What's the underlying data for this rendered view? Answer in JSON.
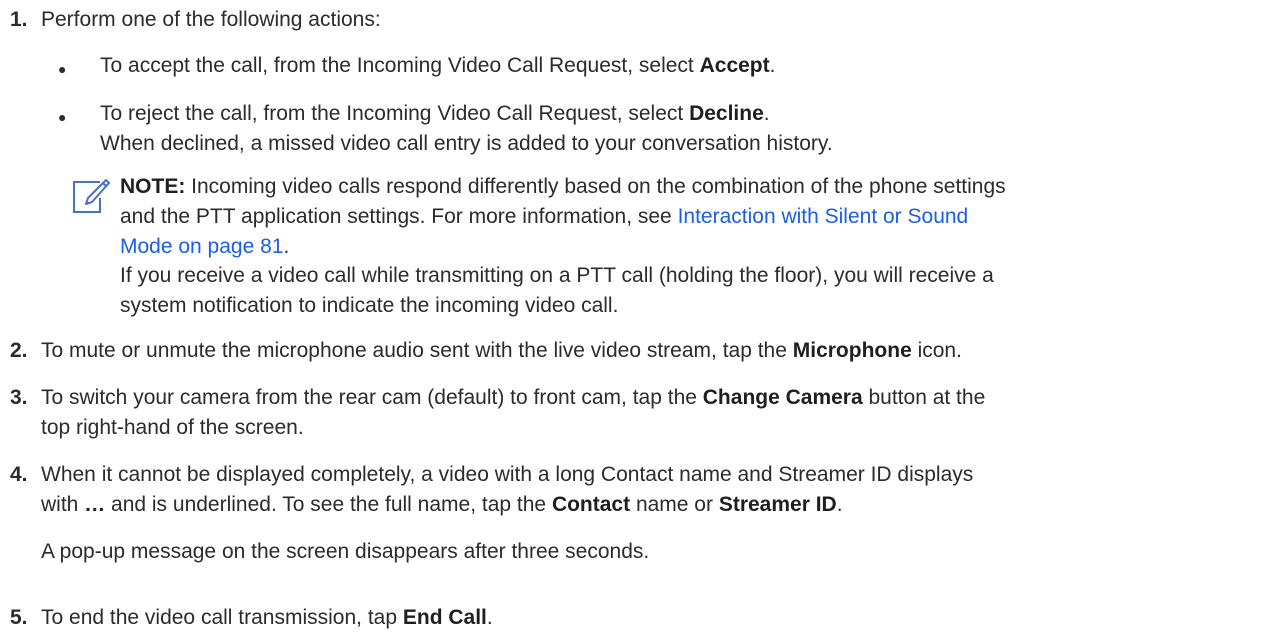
{
  "steps": [
    {
      "number": "1.",
      "text": "Perform one of the following actions:"
    },
    {
      "number": "2.",
      "text_before": "To mute or unmute the microphone audio sent with the live video stream, tap the ",
      "bold": "Microphone",
      "text_after": " icon."
    },
    {
      "number": "3.",
      "line1_before": "To switch your camera from the rear cam (default) to front cam, tap the ",
      "line1_bold": "Change Camera",
      "line1_after": " button at the",
      "line2": "top right-hand of the screen."
    },
    {
      "number": "4.",
      "line1": "When it cannot be displayed completely, a video with a long Contact name and Streamer ID displays",
      "line2_with": "with ",
      "line2_ellipsis": "…",
      "line2_mid": " and is underlined. To see the full name, tap the ",
      "line2_bold1": "Contact",
      "line2_or": " name or ",
      "line2_bold2": "Streamer ID",
      "line2_end": ".",
      "result": "A pop-up message on the screen disappears after three seconds."
    },
    {
      "number": "5.",
      "text_before": "To end the video call transmission, tap ",
      "bold": "End Call",
      "text_after": "."
    }
  ],
  "bullets": [
    {
      "symbol": "●",
      "text_before": "To accept the call, from the Incoming Video Call Request, select ",
      "bold": "Accept",
      "text_after": "."
    },
    {
      "symbol": "●",
      "text_before": "To reject the call, from the Incoming Video Call Request, select ",
      "bold": "Decline",
      "text_after": ".",
      "line2": "When declined, a missed video call entry is added to your conversation history."
    }
  ],
  "note": {
    "label": "NOTE:",
    "line1": " Incoming video calls respond differently based on the combination of the phone settings",
    "line2_before": "and the PTT application settings. For more information, see ",
    "link_line1": "Interaction with Silent or Sound",
    "link_line2": "Mode on page 81",
    "line3_after": ".",
    "line4": "If you receive a video call while transmitting on a PTT call (holding the floor), you will receive a",
    "line5": "system notification to indicate the incoming video call.",
    "icon": "note-pencil-icon"
  },
  "colors": {
    "link": "#1a5ee8",
    "icon": "#4a6fc9",
    "text": "#2b2b2b"
  }
}
